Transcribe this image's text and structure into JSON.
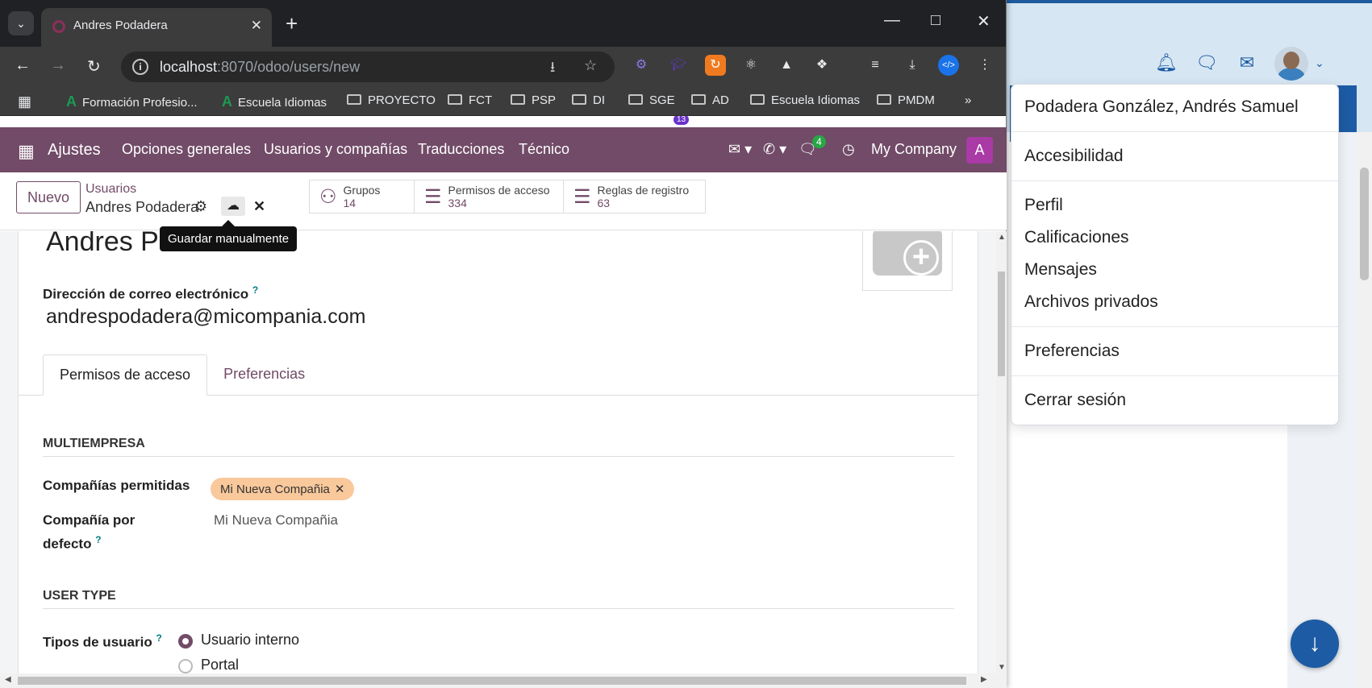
{
  "browser": {
    "tab_title": "Andres Podadera",
    "url_host": "localhost",
    "url_path": ":8070/odoo/users/new",
    "ext_badge": "13",
    "bookmarks": [
      {
        "label": "Formación Profesio...",
        "type": "a"
      },
      {
        "label": "Escuela Idiomas",
        "type": "a"
      },
      {
        "label": "PROYECTO",
        "type": "folder"
      },
      {
        "label": "FCT",
        "type": "folder"
      },
      {
        "label": "PSP",
        "type": "folder"
      },
      {
        "label": "DI",
        "type": "folder"
      },
      {
        "label": "SGE",
        "type": "folder"
      },
      {
        "label": "AD",
        "type": "folder"
      },
      {
        "label": "Escuela Idiomas",
        "type": "folder"
      },
      {
        "label": "PMDM",
        "type": "folder"
      }
    ]
  },
  "navbar": {
    "app": "Ajustes",
    "menu": [
      "Opciones generales",
      "Usuarios y compañías",
      "Traducciones",
      "Técnico"
    ],
    "chat_badge": "4",
    "company": "My Company",
    "avatar_letter": "A"
  },
  "control_panel": {
    "new_button": "Nuevo",
    "breadcrumb_parent": "Usuarios",
    "breadcrumb_current": "Andres Podadera",
    "tooltip": "Guardar manualmente",
    "smart_buttons": [
      {
        "label": "Grupos",
        "count": "14"
      },
      {
        "label": "Permisos de acceso",
        "count": "334"
      },
      {
        "label": "Reglas de registro",
        "count": "63"
      }
    ]
  },
  "form": {
    "name": "Andres Podadera",
    "email_label": "Dirección de correo electrónico",
    "email_help": "?",
    "email": "andrespodadera@micompania.com",
    "tabs": [
      "Permisos de acceso",
      "Preferencias"
    ],
    "section_multicompany": "MULTIEMPRESA",
    "allowed_companies_label": "Compañías permitidas",
    "allowed_company_tag": "Mi Nueva Compañia",
    "default_company_label_1": "Compañía por",
    "default_company_label_2": "defecto",
    "default_company": "Mi Nueva Compañia",
    "section_user_type": "USER TYPE",
    "user_type_label": "Tipos de usuario",
    "user_type_options": [
      "Usuario interno",
      "Portal"
    ],
    "user_type_selected": "Usuario interno"
  },
  "user_menu": {
    "user_name": "Podadera González, Andrés Samuel",
    "items_group1": [
      "Accesibilidad"
    ],
    "items_group2": [
      "Perfil",
      "Calificaciones",
      "Mensajes",
      "Archivos privados"
    ],
    "items_group3": [
      "Preferencias"
    ],
    "items_group4": [
      "Cerrar sesión"
    ]
  },
  "colors": {
    "odoo_primary": "#714b67",
    "background_accent": "#1d5ba4",
    "tag_color": "#f9c89b"
  }
}
